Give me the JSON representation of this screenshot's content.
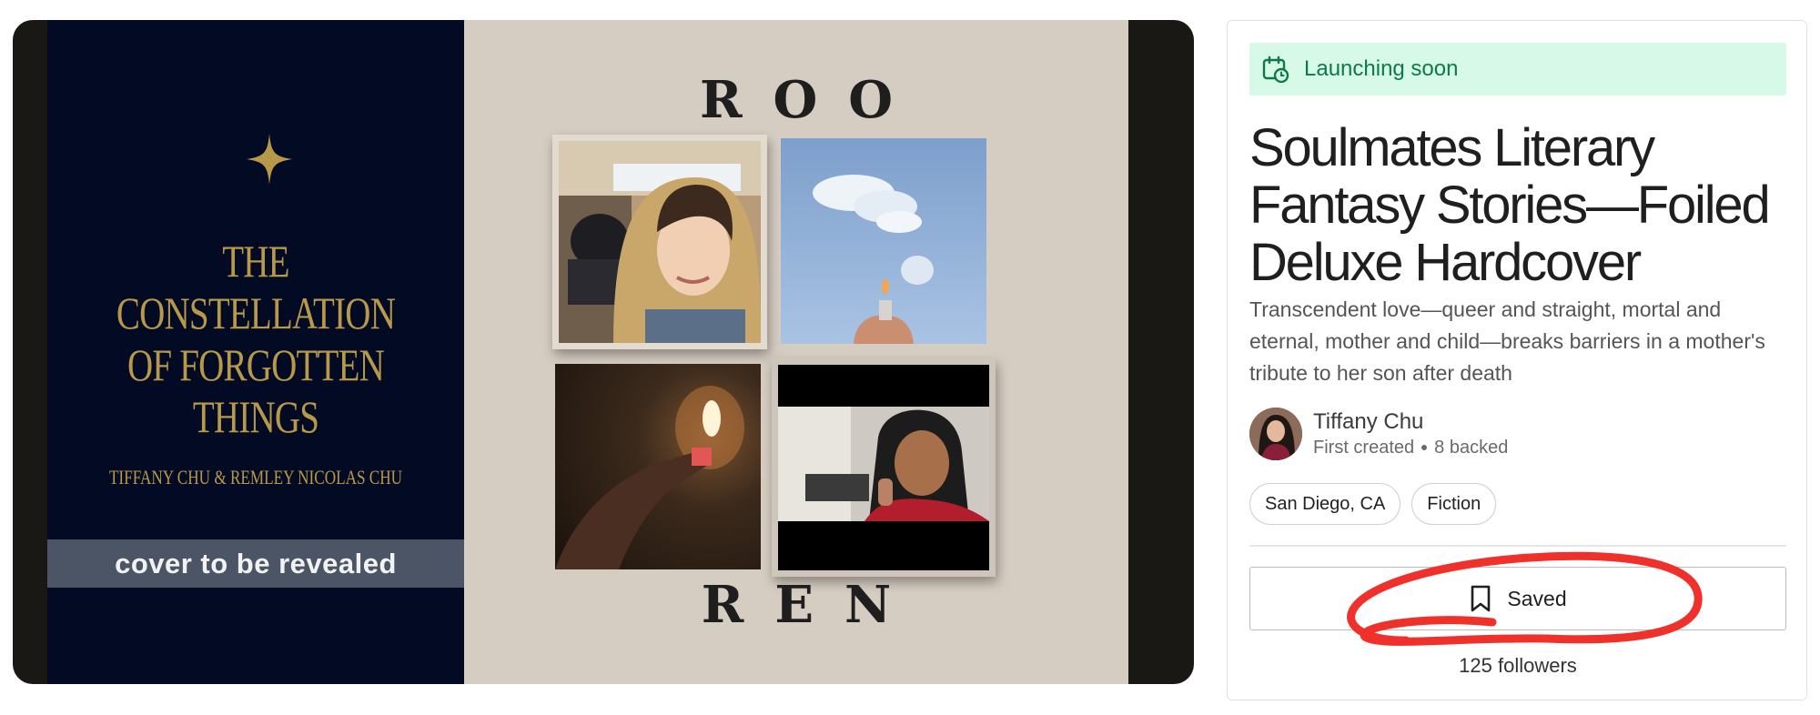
{
  "hero": {
    "cover": {
      "title": "THE\nCONSTELLATION\nOF FORGOTTEN\nTHINGS",
      "authors": "TIFFANY CHU & REMLEY NICOLAS CHU",
      "banner": "cover to be revealed"
    },
    "collage": {
      "top_word": "ROO",
      "bottom_word": "REN"
    }
  },
  "project": {
    "status_badge": "Launching soon",
    "title": "Soulmates Literary Fantasy Stories—Foiled Deluxe Hardcover",
    "blurb": "Transcendent love—queer and straight, mortal and eternal, mother and child—breaks barriers in a mother's tribute to her son after death",
    "creator": {
      "name": "Tiffany Chu",
      "status": "First created",
      "backed": "8 backed"
    },
    "tags": [
      "San Diego, CA",
      "Fiction"
    ],
    "save_label": "Saved",
    "followers": "125 followers"
  },
  "colors": {
    "badge_bg": "#d7fae8",
    "badge_text": "#0b7a48",
    "cover_bg": "#030b24",
    "cover_gold": "#b8994a",
    "annotation_red": "#f0312b"
  },
  "icons": {
    "badge": "calendar-clock-icon",
    "save": "bookmark-icon",
    "cover": "four-point-star-icon"
  }
}
